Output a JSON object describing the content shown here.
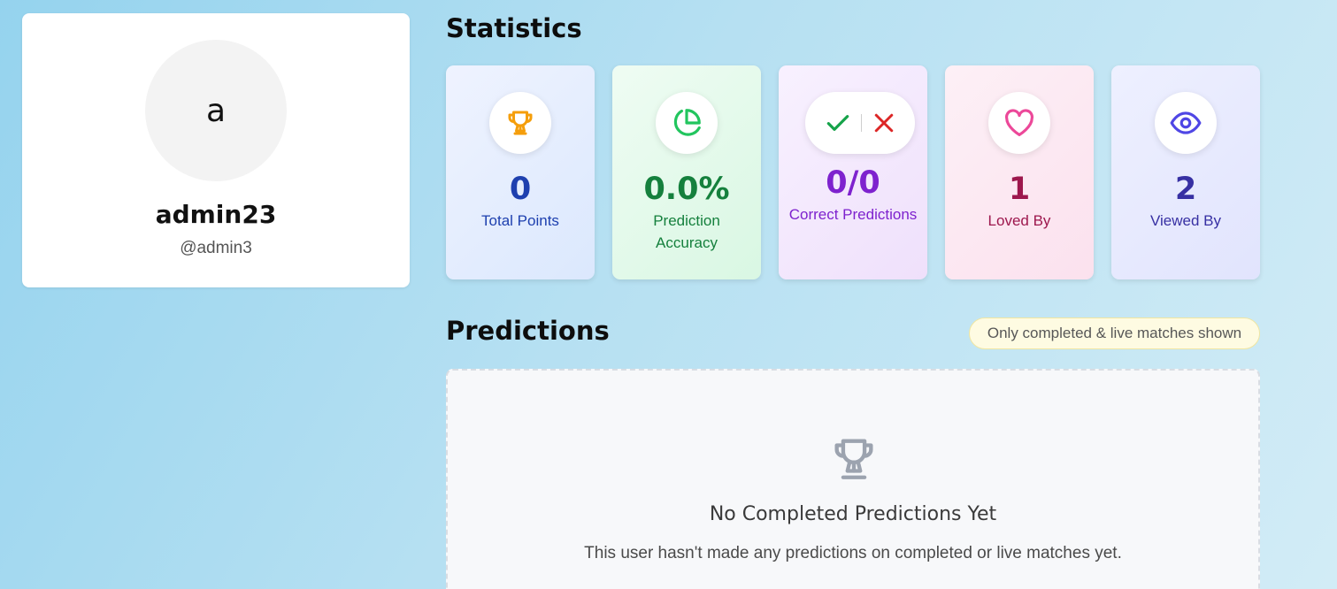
{
  "profile": {
    "avatar_initial": "a",
    "display_name": "admin23",
    "handle": "@admin3"
  },
  "statistics": {
    "title": "Statistics",
    "cards": [
      {
        "icon": "trophy-icon",
        "value": "0",
        "label": "Total Points",
        "color": "#1e40af"
      },
      {
        "icon": "pie-chart-icon",
        "value": "0.0%",
        "label": "Prediction Accuracy",
        "color": "#15803d"
      },
      {
        "icon": "check-x-icon",
        "value": "0/0",
        "label": "Correct Predictions",
        "color": "#7e22ce"
      },
      {
        "icon": "heart-icon",
        "value": "1",
        "label": "Loved By",
        "color": "#9d174d"
      },
      {
        "icon": "eye-icon",
        "value": "2",
        "label": "Viewed By",
        "color": "#3730a3"
      }
    ]
  },
  "predictions": {
    "title": "Predictions",
    "notice": "Only completed & live matches shown",
    "empty_state": {
      "icon": "trophy-icon",
      "title": "No Completed Predictions Yet",
      "description": "This user hasn't made any predictions on completed or live matches yet."
    }
  },
  "colors": {
    "trophy": "#f59e0b",
    "accuracy": "#22c55e",
    "check": "#16a34a",
    "cross": "#dc2626",
    "heart": "#ec4899",
    "eye": "#4f46e5",
    "empty_icon": "#9ca3af"
  }
}
